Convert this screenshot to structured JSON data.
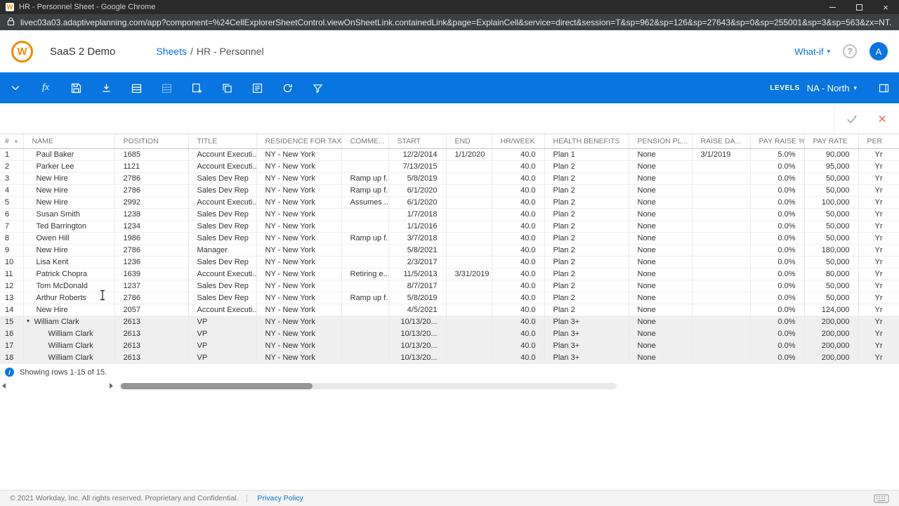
{
  "chrome": {
    "favicon_letter": "W",
    "title": "HR - Personnel Sheet - Google Chrome",
    "url": "livec03a03.adaptiveplanning.com/app?component=%24CellExplorerSheetControl.viewOnSheetLink.containedLink&page=ExplainCell&service=direct&session=T&sp=962&sp=126&sp=27643&sp=0&sp=255001&sp=3&sp=563&zx=NT..."
  },
  "icons": {
    "close": "×",
    "caret_down": "▾",
    "expand_triangle": "▼",
    "info": "i",
    "help": "?"
  },
  "header": {
    "logo_letter": "W",
    "app_name": "SaaS 2 Demo",
    "breadcrumb_link": "Sheets",
    "breadcrumb_separator": "/",
    "breadcrumb_current": "HR - Personnel",
    "whatif_label": "What-if",
    "avatar_letter": "A"
  },
  "toolbar": {
    "fx_label": "fx",
    "levels_label": "LEVELS",
    "level_value": "NA - North"
  },
  "table": {
    "columns": [
      "#",
      "NAME",
      "POSITION",
      "TITLE",
      "RESIDENCE FOR TAX",
      "COMME...",
      "START",
      "END",
      "HR/WEEK",
      "HEALTH BENEFITS",
      "PENSION PL...",
      "RAISE DA...",
      "PAY RAISE %",
      "PAY RATE",
      "PER"
    ],
    "rows": [
      {
        "num": "1",
        "name": "Paul Baker",
        "position": "1685",
        "title": "Account Executi...",
        "residence": "NY - New York",
        "comment": "",
        "start": "12/2/2014",
        "end": "1/1/2020",
        "hr_week": "40.0",
        "health": "Plan 1",
        "pension": "None",
        "raise_date": "3/1/2019",
        "pay_raise": "5.0%",
        "pay_rate": "90,000",
        "per": "Yr"
      },
      {
        "num": "2",
        "name": "Parker Lee",
        "position": "1121",
        "title": "Account Executi...",
        "residence": "NY - New York",
        "comment": "",
        "start": "7/13/2015",
        "end": "",
        "hr_week": "40.0",
        "health": "Plan 2",
        "pension": "None",
        "raise_date": "",
        "pay_raise": "0.0%",
        "pay_rate": "95,000",
        "per": "Yr"
      },
      {
        "num": "3",
        "name": "New Hire",
        "position": "2786",
        "title": "Sales Dev Rep",
        "residence": "NY - New York",
        "comment": "Ramp up f...",
        "start": "5/8/2019",
        "end": "",
        "hr_week": "40.0",
        "health": "Plan 2",
        "pension": "None",
        "raise_date": "",
        "pay_raise": "0.0%",
        "pay_rate": "50,000",
        "per": "Yr"
      },
      {
        "num": "4",
        "name": "New Hire",
        "position": "2786",
        "title": "Sales Dev Rep",
        "residence": "NY - New York",
        "comment": "Ramp up f...",
        "start": "6/1/2020",
        "end": "",
        "hr_week": "40.0",
        "health": "Plan 2",
        "pension": "None",
        "raise_date": "",
        "pay_raise": "0.0%",
        "pay_rate": "50,000",
        "per": "Yr"
      },
      {
        "num": "5",
        "name": "New Hire",
        "position": "2992",
        "title": "Account Executi...",
        "residence": "NY - New York",
        "comment": "Assumes ...",
        "start": "6/1/2020",
        "end": "",
        "hr_week": "40.0",
        "health": "Plan 2",
        "pension": "None",
        "raise_date": "",
        "pay_raise": "0.0%",
        "pay_rate": "100,000",
        "per": "Yr"
      },
      {
        "num": "6",
        "name": "Susan Smith",
        "position": "1238",
        "title": "Sales Dev Rep",
        "residence": "NY - New York",
        "comment": "",
        "start": "1/7/2018",
        "end": "",
        "hr_week": "40.0",
        "health": "Plan 2",
        "pension": "None",
        "raise_date": "",
        "pay_raise": "0.0%",
        "pay_rate": "50,000",
        "per": "Yr"
      },
      {
        "num": "7",
        "name": "Ted Barrington",
        "position": "1234",
        "title": "Sales Dev Rep",
        "residence": "NY - New York",
        "comment": "",
        "start": "1/1/2016",
        "end": "",
        "hr_week": "40.0",
        "health": "Plan 2",
        "pension": "None",
        "raise_date": "",
        "pay_raise": "0.0%",
        "pay_rate": "50,000",
        "per": "Yr"
      },
      {
        "num": "8",
        "name": "Owen Hill",
        "position": "1986",
        "title": "Sales Dev Rep",
        "residence": "NY - New York",
        "comment": "Ramp up f...",
        "start": "3/7/2018",
        "end": "",
        "hr_week": "40.0",
        "health": "Plan 2",
        "pension": "None",
        "raise_date": "",
        "pay_raise": "0.0%",
        "pay_rate": "50,000",
        "per": "Yr"
      },
      {
        "num": "9",
        "name": "New Hire",
        "position": "2786",
        "title": "Manager",
        "residence": "NY - New York",
        "comment": "",
        "start": "5/8/2021",
        "end": "",
        "hr_week": "40.0",
        "health": "Plan 2",
        "pension": "None",
        "raise_date": "",
        "pay_raise": "0.0%",
        "pay_rate": "180,000",
        "per": "Yr"
      },
      {
        "num": "10",
        "name": "Lisa Kent",
        "position": "1236",
        "title": "Sales Dev Rep",
        "residence": "NY - New York",
        "comment": "",
        "start": "2/3/2017",
        "end": "",
        "hr_week": "40.0",
        "health": "Plan 2",
        "pension": "None",
        "raise_date": "",
        "pay_raise": "0.0%",
        "pay_rate": "50,000",
        "per": "Yr"
      },
      {
        "num": "11",
        "name": "Patrick Chopra",
        "position": "1639",
        "title": "Account Executi...",
        "residence": "NY - New York",
        "comment": "Retiring e...",
        "start": "11/5/2013",
        "end": "3/31/2019",
        "hr_week": "40.0",
        "health": "Plan 2",
        "pension": "None",
        "raise_date": "",
        "pay_raise": "0.0%",
        "pay_rate": "80,000",
        "per": "Yr"
      },
      {
        "num": "12",
        "name": "Tom McDonald",
        "position": "1237",
        "title": "Sales Dev Rep",
        "residence": "NY - New York",
        "comment": "",
        "start": "8/7/2017",
        "end": "",
        "hr_week": "40.0",
        "health": "Plan 2",
        "pension": "None",
        "raise_date": "",
        "pay_raise": "0.0%",
        "pay_rate": "50,000",
        "per": "Yr"
      },
      {
        "num": "13",
        "name": "Arthur Roberts",
        "position": "2786",
        "title": "Sales Dev Rep",
        "residence": "NY - New York",
        "comment": "Ramp up f...",
        "start": "5/8/2019",
        "end": "",
        "hr_week": "40.0",
        "health": "Plan 2",
        "pension": "None",
        "raise_date": "",
        "pay_raise": "0.0%",
        "pay_rate": "50,000",
        "per": "Yr"
      },
      {
        "num": "14",
        "name": "New Hire",
        "position": "2057",
        "title": "Account Executi...",
        "residence": "NY - New York",
        "comment": "",
        "start": "4/5/2021",
        "end": "",
        "hr_week": "40.0",
        "health": "Plan 2",
        "pension": "None",
        "raise_date": "",
        "pay_raise": "0.0%",
        "pay_rate": "124,000",
        "per": "Yr"
      },
      {
        "num": "15",
        "name": "William Clark",
        "expanded": true,
        "shaded": true,
        "position": "2613",
        "title": "VP",
        "residence": "NY - New York",
        "comment": "",
        "start": "10/13/20...",
        "end": "",
        "hr_week": "40.0",
        "health": "Plan 3+",
        "pension": "None",
        "raise_date": "",
        "pay_raise": "0.0%",
        "pay_rate": "200,000",
        "per": "Yr"
      },
      {
        "num": "16",
        "name": "William Clark",
        "split": true,
        "shaded": true,
        "position": "2613",
        "title": "VP",
        "residence": "NY - New York",
        "comment": "",
        "start": "10/13/20...",
        "end": "",
        "hr_week": "40.0",
        "health": "Plan 3+",
        "pension": "None",
        "raise_date": "",
        "pay_raise": "0.0%",
        "pay_rate": "200,000",
        "per": "Yr"
      },
      {
        "num": "17",
        "name": "William Clark",
        "split": true,
        "shaded": true,
        "position": "2613",
        "title": "VP",
        "residence": "NY - New York",
        "comment": "",
        "start": "10/13/20...",
        "end": "",
        "hr_week": "40.0",
        "health": "Plan 3+",
        "pension": "None",
        "raise_date": "",
        "pay_raise": "0.0%",
        "pay_rate": "200,000",
        "per": "Yr"
      },
      {
        "num": "18",
        "name": "William Clark",
        "split": true,
        "shaded": true,
        "position": "2613",
        "title": "VP",
        "residence": "NY - New York",
        "comment": "",
        "start": "10/13/20...",
        "end": "",
        "hr_week": "40.0",
        "health": "Plan 3+",
        "pension": "None",
        "raise_date": "",
        "pay_raise": "0.0%",
        "pay_rate": "200,000",
        "per": "Yr"
      }
    ]
  },
  "status": {
    "text": "Showing rows 1-15 of 15."
  },
  "footer": {
    "copyright": "© 2021 Workday, Inc. All rights reserved. Proprietary and Confidential.",
    "privacy": "Privacy Policy"
  }
}
